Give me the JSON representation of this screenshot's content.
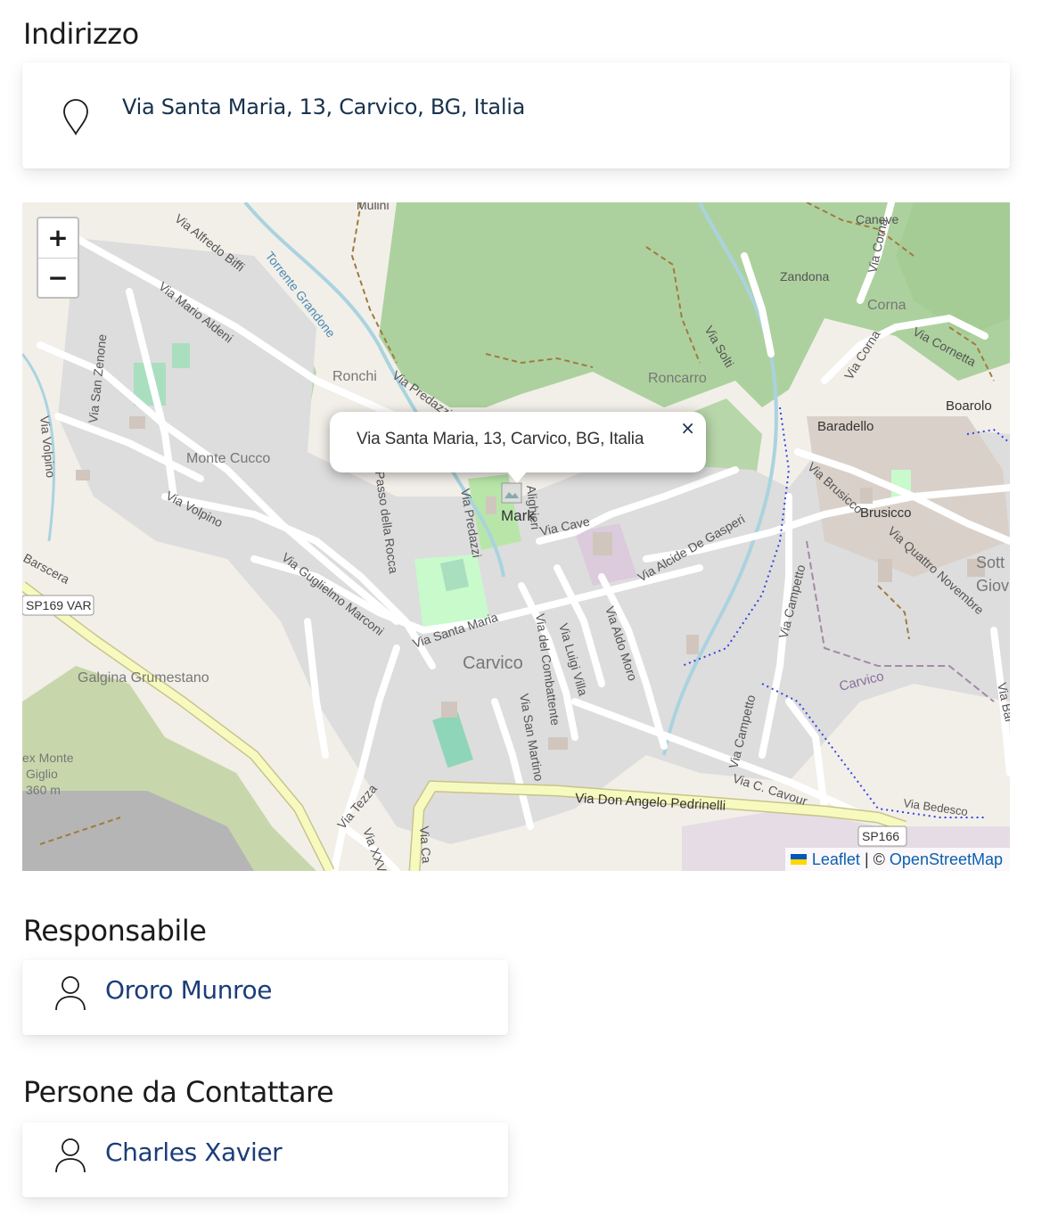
{
  "address": {
    "heading": "Indirizzo",
    "icon": "map-pin-icon",
    "text": "Via Santa Maria, 13, Carvico, BG, Italia"
  },
  "map": {
    "zoom_in_label": "+",
    "zoom_out_label": "−",
    "popup_text": "Via Santa Maria, 13, Carvico, BG, Italia",
    "popup_close_label": "×",
    "marker_alt": "Mark",
    "attribution_leaflet": "Leaflet",
    "attribution_sep": "| ©",
    "attribution_osm": "OpenStreetMap",
    "labels": {
      "mulini": "Mulini",
      "via_alfredo_biffi": "Via Alfredo Biffi",
      "torrente_grandone": "Torrente Grandone",
      "caneve": "Caneve",
      "via_corna": "Via Corna",
      "zandona": "Zandona",
      "corna": "Corna",
      "via_mario_aldeni": "Via Mario Aldeni",
      "via_solti": "Via Solti",
      "via_cornetta": "Via Cornetta",
      "ronchi": "Ronchi",
      "via_predazzi": "Via Predazzi",
      "roncarro": "Roncarro",
      "via_corna_2": "Via Corna",
      "boarolo": "Boarolo",
      "via_san_zenone": "Via San Zenone",
      "via_volpino": "Via Volpino",
      "baradello": "Baradello",
      "monte_cucco": "Monte Cucco",
      "passo_della_rocca": "Passo della Rocca",
      "via_predazzi_2": "Via Predazzi",
      "via_alighieri": "Alighieri",
      "via_brusicco": "Via Brusicco",
      "brusicco": "Brusicco",
      "via_volpino_2": "Via Volpino",
      "via_cave": "Via Cave",
      "via_alcide_de_gasperi": "Via Alcide De Gasperi",
      "via_quattro_novembre": "Via Quattro Novembre",
      "sotto_il_monte": "Sott",
      "giov": "Giov",
      "barscera": "Barscera",
      "sp169": "SP169 VAR",
      "via_guglielmo_marconi": "Via Guglielmo Marconi",
      "via_campetto": "Via Campetto",
      "via_santa_maria": "Via Santa Maria",
      "via_del_combattente": "Via del Combattente",
      "via_luigi_villa": "Via Luigi Villa",
      "via_aldo_moro": "Via Aldo Moro",
      "carvico": "Carvico",
      "carvico_boundary": "Carvico",
      "galgina": "Galgina Grumestano",
      "via_san_martino": "Via San Martino",
      "ex_monte": "ex Monte",
      "giglio": "Giglio",
      "quota": "360 m",
      "via_campetto_2": "Via Campetto",
      "via_c_cavour": "Via C. Cavour",
      "via_don_angelo": "Via Don Angelo Pedrinelli",
      "via_bedesco": "Via Bedesco",
      "sp166": "SP166",
      "via_tezza": "Via Tezza",
      "via_xxv": "Via XXV A",
      "via_ca": "Via Ca",
      "via_bar": "Via Bar"
    }
  },
  "responsabile": {
    "heading": "Responsabile",
    "name": "Ororo Munroe"
  },
  "contatti": {
    "heading": "Persone da Contattare",
    "name": "Charles Xavier"
  },
  "colors": {
    "link": "#1c3d7a",
    "address_text": "#17324d",
    "map_land": "#f2efe9",
    "map_forest": "#add19e",
    "map_built": "#d9d0c9",
    "map_major_road": "#f7fabf"
  }
}
